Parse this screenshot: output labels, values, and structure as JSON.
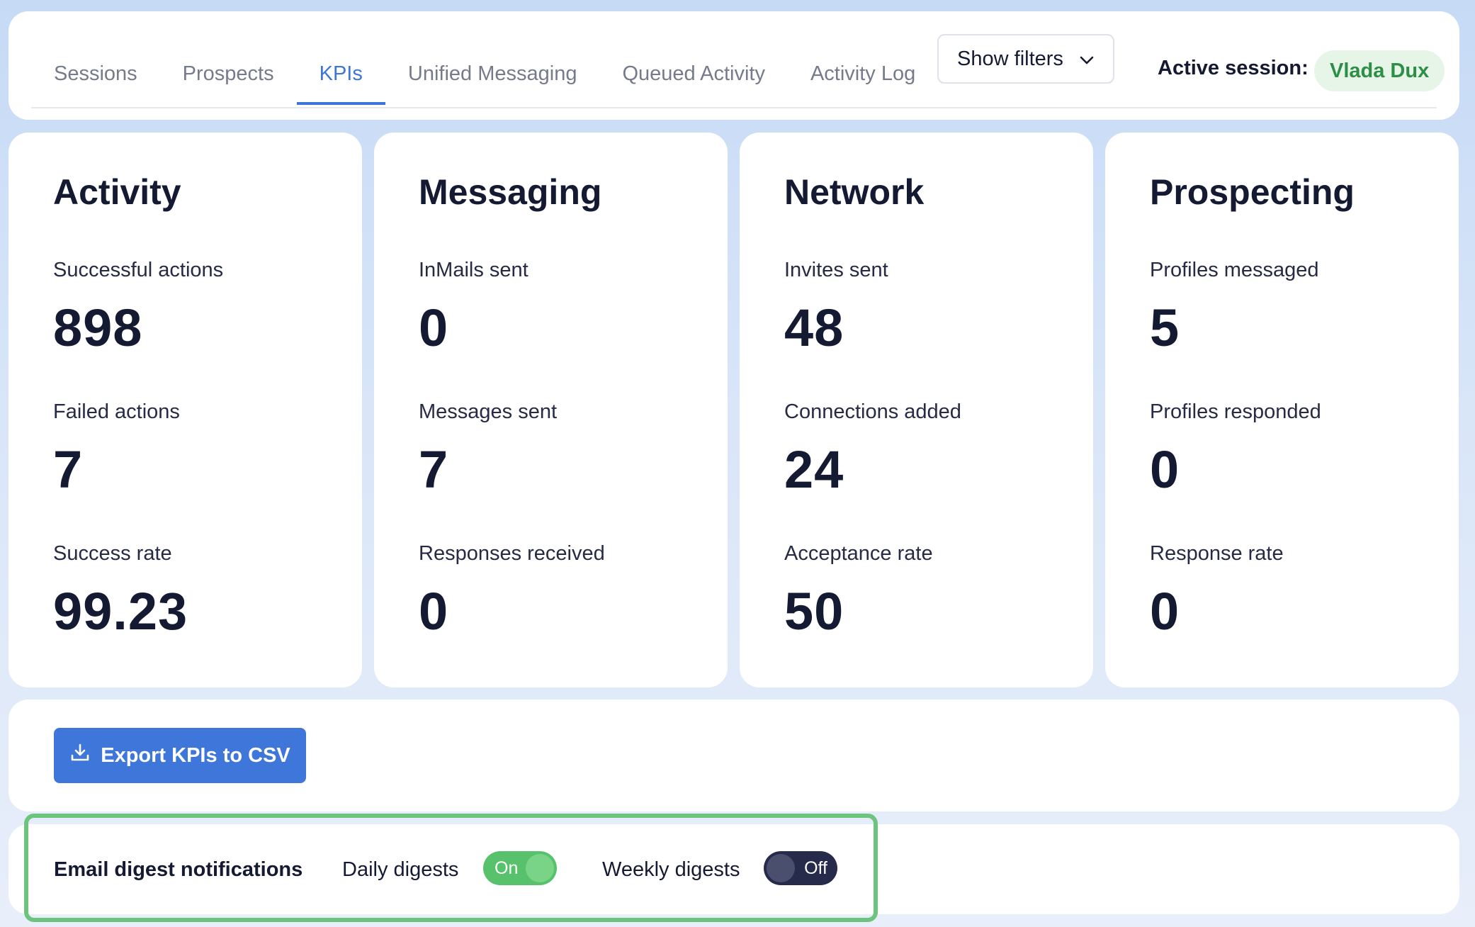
{
  "tabs": [
    {
      "label": "Sessions",
      "active": false
    },
    {
      "label": "Prospects",
      "active": false
    },
    {
      "label": "KPIs",
      "active": true
    },
    {
      "label": "Unified Messaging",
      "active": false
    },
    {
      "label": "Queued Activity",
      "active": false
    },
    {
      "label": "Activity Log",
      "active": false
    }
  ],
  "filters_label": "Show filters",
  "session": {
    "label": "Active session:",
    "name": "Vlada Dux"
  },
  "cards": {
    "activity": {
      "title": "Activity",
      "metrics": [
        {
          "label": "Successful actions",
          "value": "898"
        },
        {
          "label": "Failed actions",
          "value": "7"
        },
        {
          "label": "Success rate",
          "value": "99.23"
        }
      ]
    },
    "messaging": {
      "title": "Messaging",
      "metrics": [
        {
          "label": "InMails sent",
          "value": "0"
        },
        {
          "label": "Messages sent",
          "value": "7"
        },
        {
          "label": "Responses received",
          "value": "0"
        }
      ]
    },
    "network": {
      "title": "Network",
      "metrics": [
        {
          "label": "Invites sent",
          "value": "48"
        },
        {
          "label": "Connections added",
          "value": "24"
        },
        {
          "label": "Acceptance rate",
          "value": "50"
        }
      ]
    },
    "prospecting": {
      "title": "Prospecting",
      "metrics": [
        {
          "label": "Profiles messaged",
          "value": "5"
        },
        {
          "label": "Profiles responded",
          "value": "0"
        },
        {
          "label": "Response rate",
          "value": "0"
        }
      ]
    }
  },
  "export_label": "Export KPIs to CSV",
  "digest": {
    "title": "Email digest notifications",
    "daily": {
      "label": "Daily digests",
      "state": "On"
    },
    "weekly": {
      "label": "Weekly digests",
      "state": "Off"
    }
  },
  "colors": {
    "accent": "#3d75d8",
    "export_button": "#3f76da",
    "session_chip_text": "#2d8f47",
    "toggle_on": "#57c26b",
    "toggle_off": "#262b4b",
    "highlight_border": "#6cc47d"
  },
  "icons": {
    "filters": "chevron-down-icon",
    "export": "download-icon"
  }
}
